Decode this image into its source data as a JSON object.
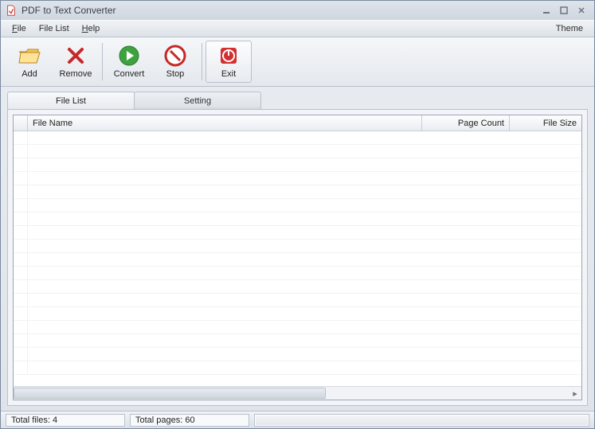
{
  "window": {
    "title": "PDF to Text Converter"
  },
  "menu": {
    "file": "File",
    "filelist": "File List",
    "help": "Help",
    "theme": "Theme"
  },
  "toolbar": {
    "add": "Add",
    "remove": "Remove",
    "convert": "Convert",
    "stop": "Stop",
    "exit": "Exit"
  },
  "tabs": {
    "filelist": "File List",
    "setting": "Setting"
  },
  "columns": {
    "filename": "File Name",
    "pagecount": "Page Count",
    "filesize": "File Size"
  },
  "status": {
    "total_files_label": "Total files:",
    "total_files_value": "4",
    "total_pages_label": "Total pages:",
    "total_pages_value": "60"
  },
  "rows": []
}
